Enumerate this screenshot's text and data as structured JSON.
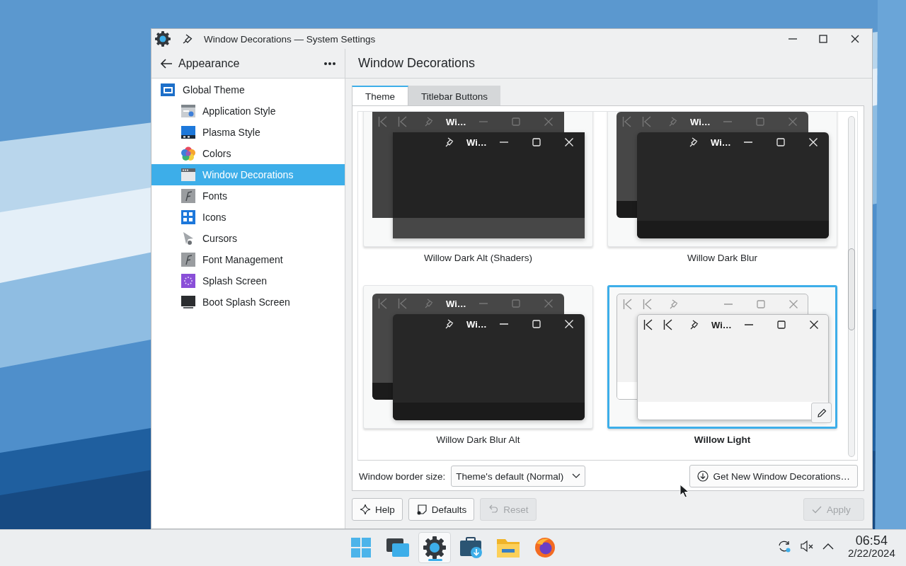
{
  "window": {
    "title": "Window Decorations — System Settings"
  },
  "sidebar": {
    "header": "Appearance",
    "items": [
      {
        "label": "Global Theme",
        "selected": false,
        "children": [
          {
            "label": "Application Style",
            "selected": false
          },
          {
            "label": "Plasma Style",
            "selected": false
          },
          {
            "label": "Colors",
            "selected": false
          },
          {
            "label": "Window Decorations",
            "selected": true
          },
          {
            "label": "Fonts",
            "selected": false
          },
          {
            "label": "Icons",
            "selected": false
          },
          {
            "label": "Cursors",
            "selected": false
          },
          {
            "label": "Font Management",
            "selected": false
          },
          {
            "label": "Splash Screen",
            "selected": false
          },
          {
            "label": "Boot Splash Screen",
            "selected": false
          }
        ]
      }
    ]
  },
  "page": {
    "title": "Window Decorations",
    "tabs": [
      {
        "label": "Theme",
        "selected": true
      },
      {
        "label": "Titlebar Buttons",
        "selected": false
      }
    ],
    "themes": [
      {
        "name": "Willow Dark Alt (Shaders)",
        "kind": "dark-alt",
        "selected": false,
        "windows": [
          {
            "title": "Wi…",
            "keep_buttons": true
          },
          {
            "title": "Wi…",
            "keep_buttons": false
          }
        ]
      },
      {
        "name": "Willow Dark Blur",
        "kind": "dark-blur",
        "selected": false,
        "windows": [
          {
            "title": "Wi…",
            "keep_buttons": true
          },
          {
            "title": "Wi…",
            "keep_buttons": false
          }
        ]
      },
      {
        "name": "Willow Dark Blur Alt",
        "kind": "dark-blur",
        "selected": false,
        "windows": [
          {
            "title": "Wi…",
            "keep_buttons": true
          },
          {
            "title": "Wi…",
            "keep_buttons": false
          }
        ]
      },
      {
        "name": "Willow Light",
        "kind": "light",
        "selected": true,
        "windows": [
          {
            "keep_buttons": true
          },
          {
            "title": "Wi…",
            "keep_buttons": true
          }
        ]
      }
    ],
    "border_size": {
      "label": "Window border size:",
      "value": "Theme's default (Normal)"
    },
    "get_new_button": "Get New Window Decorations…",
    "buttons": [
      {
        "label": "Help",
        "disabled": false
      },
      {
        "label": "Defaults",
        "disabled": false
      },
      {
        "label": "Reset",
        "disabled": true
      },
      {
        "label": "Apply",
        "disabled": true
      }
    ]
  },
  "taskbar": {
    "apps": [
      {
        "selected": false
      },
      {
        "selected": false
      },
      {
        "selected": true
      },
      {
        "selected": false
      },
      {
        "selected": false
      },
      {
        "selected": false
      }
    ],
    "clock": {
      "time": "06:54",
      "date": "2/22/2024"
    }
  }
}
